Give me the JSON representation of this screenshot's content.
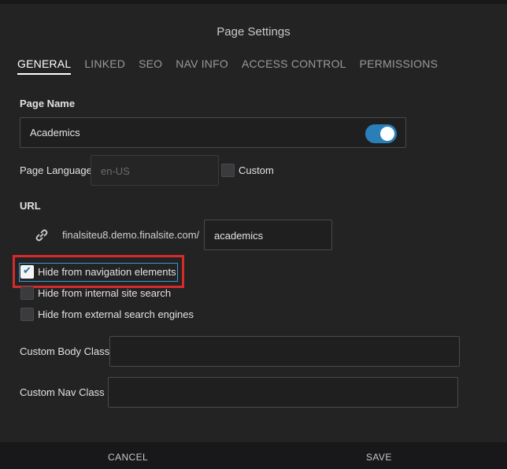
{
  "dialog": {
    "title": "Page Settings"
  },
  "tabs": [
    {
      "label": "GENERAL",
      "active": true
    },
    {
      "label": "LINKED",
      "active": false
    },
    {
      "label": "SEO",
      "active": false
    },
    {
      "label": "NAV INFO",
      "active": false
    },
    {
      "label": "ACCESS CONTROL",
      "active": false
    },
    {
      "label": "PERMISSIONS",
      "active": false
    }
  ],
  "page_name": {
    "label": "Page Name",
    "value": "Academics",
    "toggle_on": true
  },
  "page_language": {
    "label": "Page Language",
    "placeholder": "en-US",
    "custom_label": "Custom",
    "custom_checked": false
  },
  "url": {
    "label": "URL",
    "domain": "finalsiteu8.demo.finalsite.com/",
    "slug": "academics",
    "icon": "link-icon"
  },
  "checkboxes": [
    {
      "label": "Hide from navigation elements",
      "checked": true
    },
    {
      "label": "Hide from internal site search",
      "checked": false
    },
    {
      "label": "Hide from external search engines",
      "checked": false
    }
  ],
  "custom_body_class": {
    "label": "Custom Body Class",
    "value": ""
  },
  "custom_nav_class": {
    "label": "Custom Nav Class",
    "value": ""
  },
  "footer": {
    "cancel": "CANCEL",
    "save": "SAVE"
  },
  "colors": {
    "accent": "#2a7fb9",
    "highlight": "#d62b2b",
    "background": "#232324"
  }
}
